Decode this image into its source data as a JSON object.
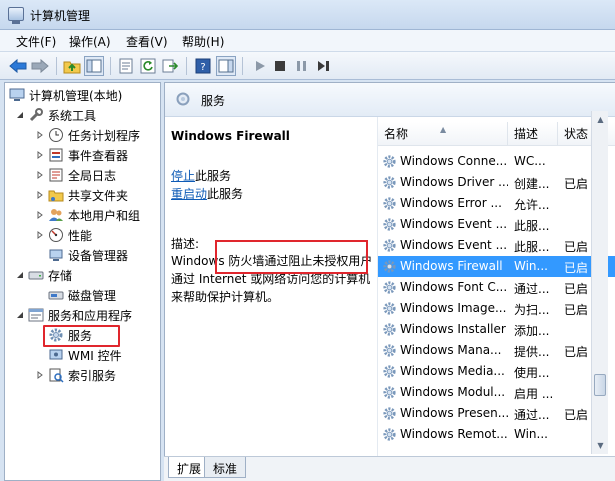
{
  "window": {
    "title": "计算机管理"
  },
  "menu": [
    "文件(F)",
    "操作(A)",
    "查看(V)",
    "帮助(H)"
  ],
  "tree": {
    "root": "计算机管理(本地)",
    "system_tools": "系统工具",
    "task_scheduler": "任务计划程序",
    "event_viewer": "事件查看器",
    "global_log": "全局日志",
    "shared_folders": "共享文件夹",
    "local_users": "本地用户和组",
    "performance": "性能",
    "device_manager": "设备管理器",
    "storage": "存储",
    "disk_management": "磁盘管理",
    "services_apps": "服务和应用程序",
    "services": "服务",
    "wmi": "WMI 控件",
    "indexing": "索引服务"
  },
  "header": {
    "title": "服务"
  },
  "detail": {
    "service_title": "Windows Firewall",
    "stop_link": "停止",
    "stop_rest": "此服务",
    "restart_link": "重启动",
    "restart_rest": "此服务",
    "desc_label": "描述:",
    "desc_text": "Windows 防火墙通过阻止未授权用户通过 Internet 或网络访问您的计算机来帮助保护计算机。"
  },
  "columns": {
    "name": "名称",
    "desc": "描述",
    "state": "状态"
  },
  "services": [
    {
      "name": "Windows Conne...",
      "desc": "WC...",
      "state": ""
    },
    {
      "name": "Windows Driver ...",
      "desc": "创建...",
      "state": "已启"
    },
    {
      "name": "Windows Error ...",
      "desc": "允许...",
      "state": ""
    },
    {
      "name": "Windows Event ...",
      "desc": "此服...",
      "state": ""
    },
    {
      "name": "Windows Event ...",
      "desc": "此服...",
      "state": "已启"
    },
    {
      "name": "Windows Firewall",
      "desc": "Win...",
      "state": "已启"
    },
    {
      "name": "Windows Font C...",
      "desc": "通过...",
      "state": "已启"
    },
    {
      "name": "Windows Image...",
      "desc": "为扫...",
      "state": "已启"
    },
    {
      "name": "Windows Installer",
      "desc": "添加...",
      "state": ""
    },
    {
      "name": "Windows Mana...",
      "desc": "提供...",
      "state": "已启"
    },
    {
      "name": "Windows Media...",
      "desc": "使用...",
      "state": ""
    },
    {
      "name": "Windows Modul...",
      "desc": "启用 ...",
      "state": ""
    },
    {
      "name": "Windows Presen...",
      "desc": "通过...",
      "state": "已启"
    },
    {
      "name": "Windows Remot...",
      "desc": "Win...",
      "state": ""
    }
  ],
  "selected_service": "Windows Firewall",
  "tabs": {
    "extended": "扩展",
    "standard": "标准"
  },
  "colors": {
    "selection": "#3399ff",
    "highlight_box": "#e0262d",
    "link": "#0e5bb6"
  }
}
